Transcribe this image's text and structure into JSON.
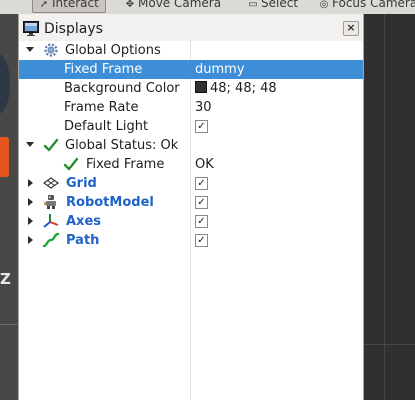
{
  "toolbar": {
    "tools": [
      {
        "label": "Interact",
        "icon": "interact-icon",
        "active": true
      },
      {
        "label": "Move Camera",
        "icon": "move-camera-icon",
        "active": false
      },
      {
        "label": "Select",
        "icon": "select-icon",
        "active": false
      },
      {
        "label": "Focus Camera",
        "icon": "focus-camera-icon",
        "active": false
      }
    ]
  },
  "launcher": {
    "partial_glyph": "Z"
  },
  "panel": {
    "title": "Displays",
    "close_label": "×",
    "rows": {
      "global_options": {
        "label": "Global Options"
      },
      "fixed_frame": {
        "label": "Fixed Frame",
        "value": "dummy"
      },
      "background_color": {
        "label": "Background Color",
        "value": "48; 48; 48",
        "swatch_color": "#303030"
      },
      "frame_rate": {
        "label": "Frame Rate",
        "value": "30"
      },
      "default_light": {
        "label": "Default Light",
        "checked": true,
        "check_glyph": "✓"
      },
      "global_status": {
        "label": "Global Status: Ok"
      },
      "status_fixed_frame": {
        "label": "Fixed Frame",
        "value": "OK"
      },
      "plugins": [
        {
          "label": "Grid",
          "icon": "grid-icon",
          "checked": true,
          "check_glyph": "✓"
        },
        {
          "label": "RobotModel",
          "icon": "robot-model-icon",
          "checked": true,
          "check_glyph": "✓"
        },
        {
          "label": "Axes",
          "icon": "axes-icon",
          "checked": true,
          "check_glyph": "✓"
        },
        {
          "label": "Path",
          "icon": "path-icon",
          "checked": true,
          "check_glyph": "✓"
        }
      ]
    }
  },
  "colors": {
    "selection": "#3d8ed7",
    "plugin_text": "#1f62c9",
    "status_ok": "#2e8b2e"
  }
}
